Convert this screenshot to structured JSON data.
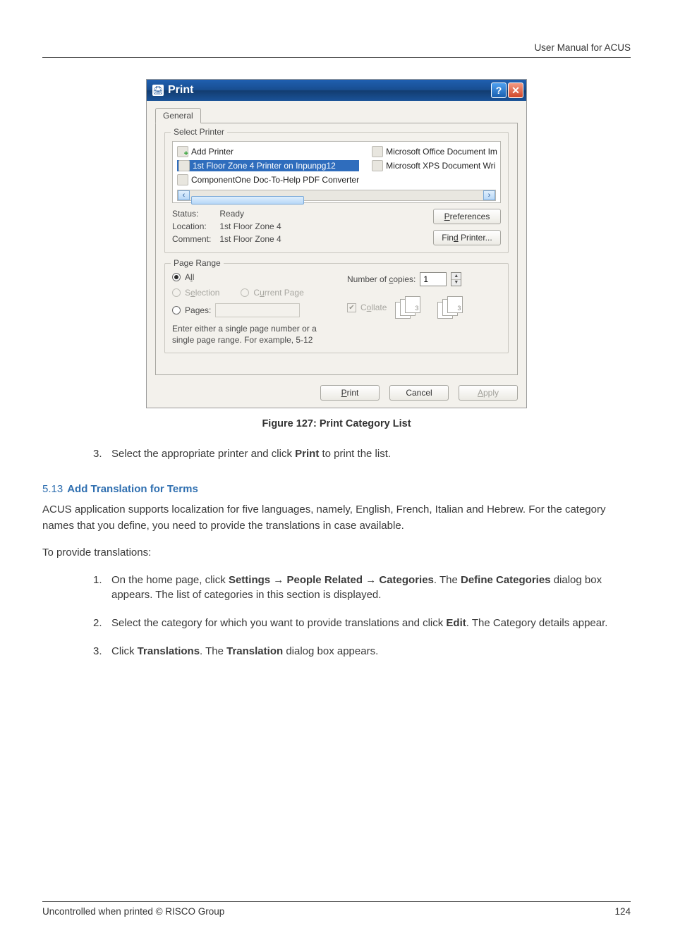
{
  "header_text": "User Manual for ACUS",
  "dialog": {
    "title": "Print",
    "tab": "General",
    "group_select_printer": "Select Printer",
    "printers_left": [
      {
        "label": "Add Printer",
        "icon": "add"
      },
      {
        "label": "1st Floor Zone 4 Printer on Inpunpg12",
        "icon": "printer",
        "selected": true
      },
      {
        "label": "ComponentOne Doc-To-Help PDF Converter",
        "icon": "printer"
      }
    ],
    "printers_right": [
      {
        "label": "Microsoft Office Document Im"
      },
      {
        "label": "Microsoft XPS Document Wri"
      }
    ],
    "status_labels": "Status:",
    "status_value": "Ready",
    "location_label": "Location:",
    "location_value": "1st Floor Zone 4",
    "comment_label": "Comment:",
    "comment_value": "1st Floor Zone 4",
    "btn_preferences": "Preferences",
    "btn_find_printer": "Find Printer...",
    "group_page_range": "Page Range",
    "radio_all": "All",
    "radio_selection": "Selection",
    "radio_current": "Current Page",
    "radio_pages": "Pages:",
    "range_hint": "Enter either a single page number or a single page range.  For example, 5-12",
    "copies_label": "Number of copies:",
    "copies_value": "1",
    "collate_label": "Collate",
    "btn_print": "Print",
    "btn_cancel": "Cancel",
    "btn_apply": "Apply"
  },
  "figure_caption": "Figure 127: Print Category List",
  "step3": {
    "num": "3",
    "pre": "Select the appropriate printer and click ",
    "bold": "Print",
    "post": " to print the list."
  },
  "section": {
    "num": "5.13",
    "title": "Add Translation for Terms"
  },
  "para1": "ACUS application supports localization for five languages, namely, English, French, Italian and Hebrew. For the category names that you define, you need to provide the translations in case available.",
  "para2": "To provide translations:",
  "steps": {
    "s1": {
      "num": "1",
      "a": "On the home page, click ",
      "b": "Settings",
      "c": " ",
      "d": "People Related",
      "e": " ",
      "f": "Categories",
      "g": ". The ",
      "h": "Define Categories",
      "i": " dialog box appears. The list of categories in this section is displayed."
    },
    "s2": {
      "num": "2",
      "a": "Select the category for which you want to provide translations and click ",
      "b": "Edit",
      "c": ". The Category details appear."
    },
    "s3": {
      "num": "3",
      "a": "Click ",
      "b": "Translations",
      "c": ". The ",
      "d": "Translation",
      "e": " dialog box appears."
    }
  },
  "footer": {
    "left": "Uncontrolled when printed © RISCO Group",
    "right": "124"
  },
  "arrow": "→"
}
